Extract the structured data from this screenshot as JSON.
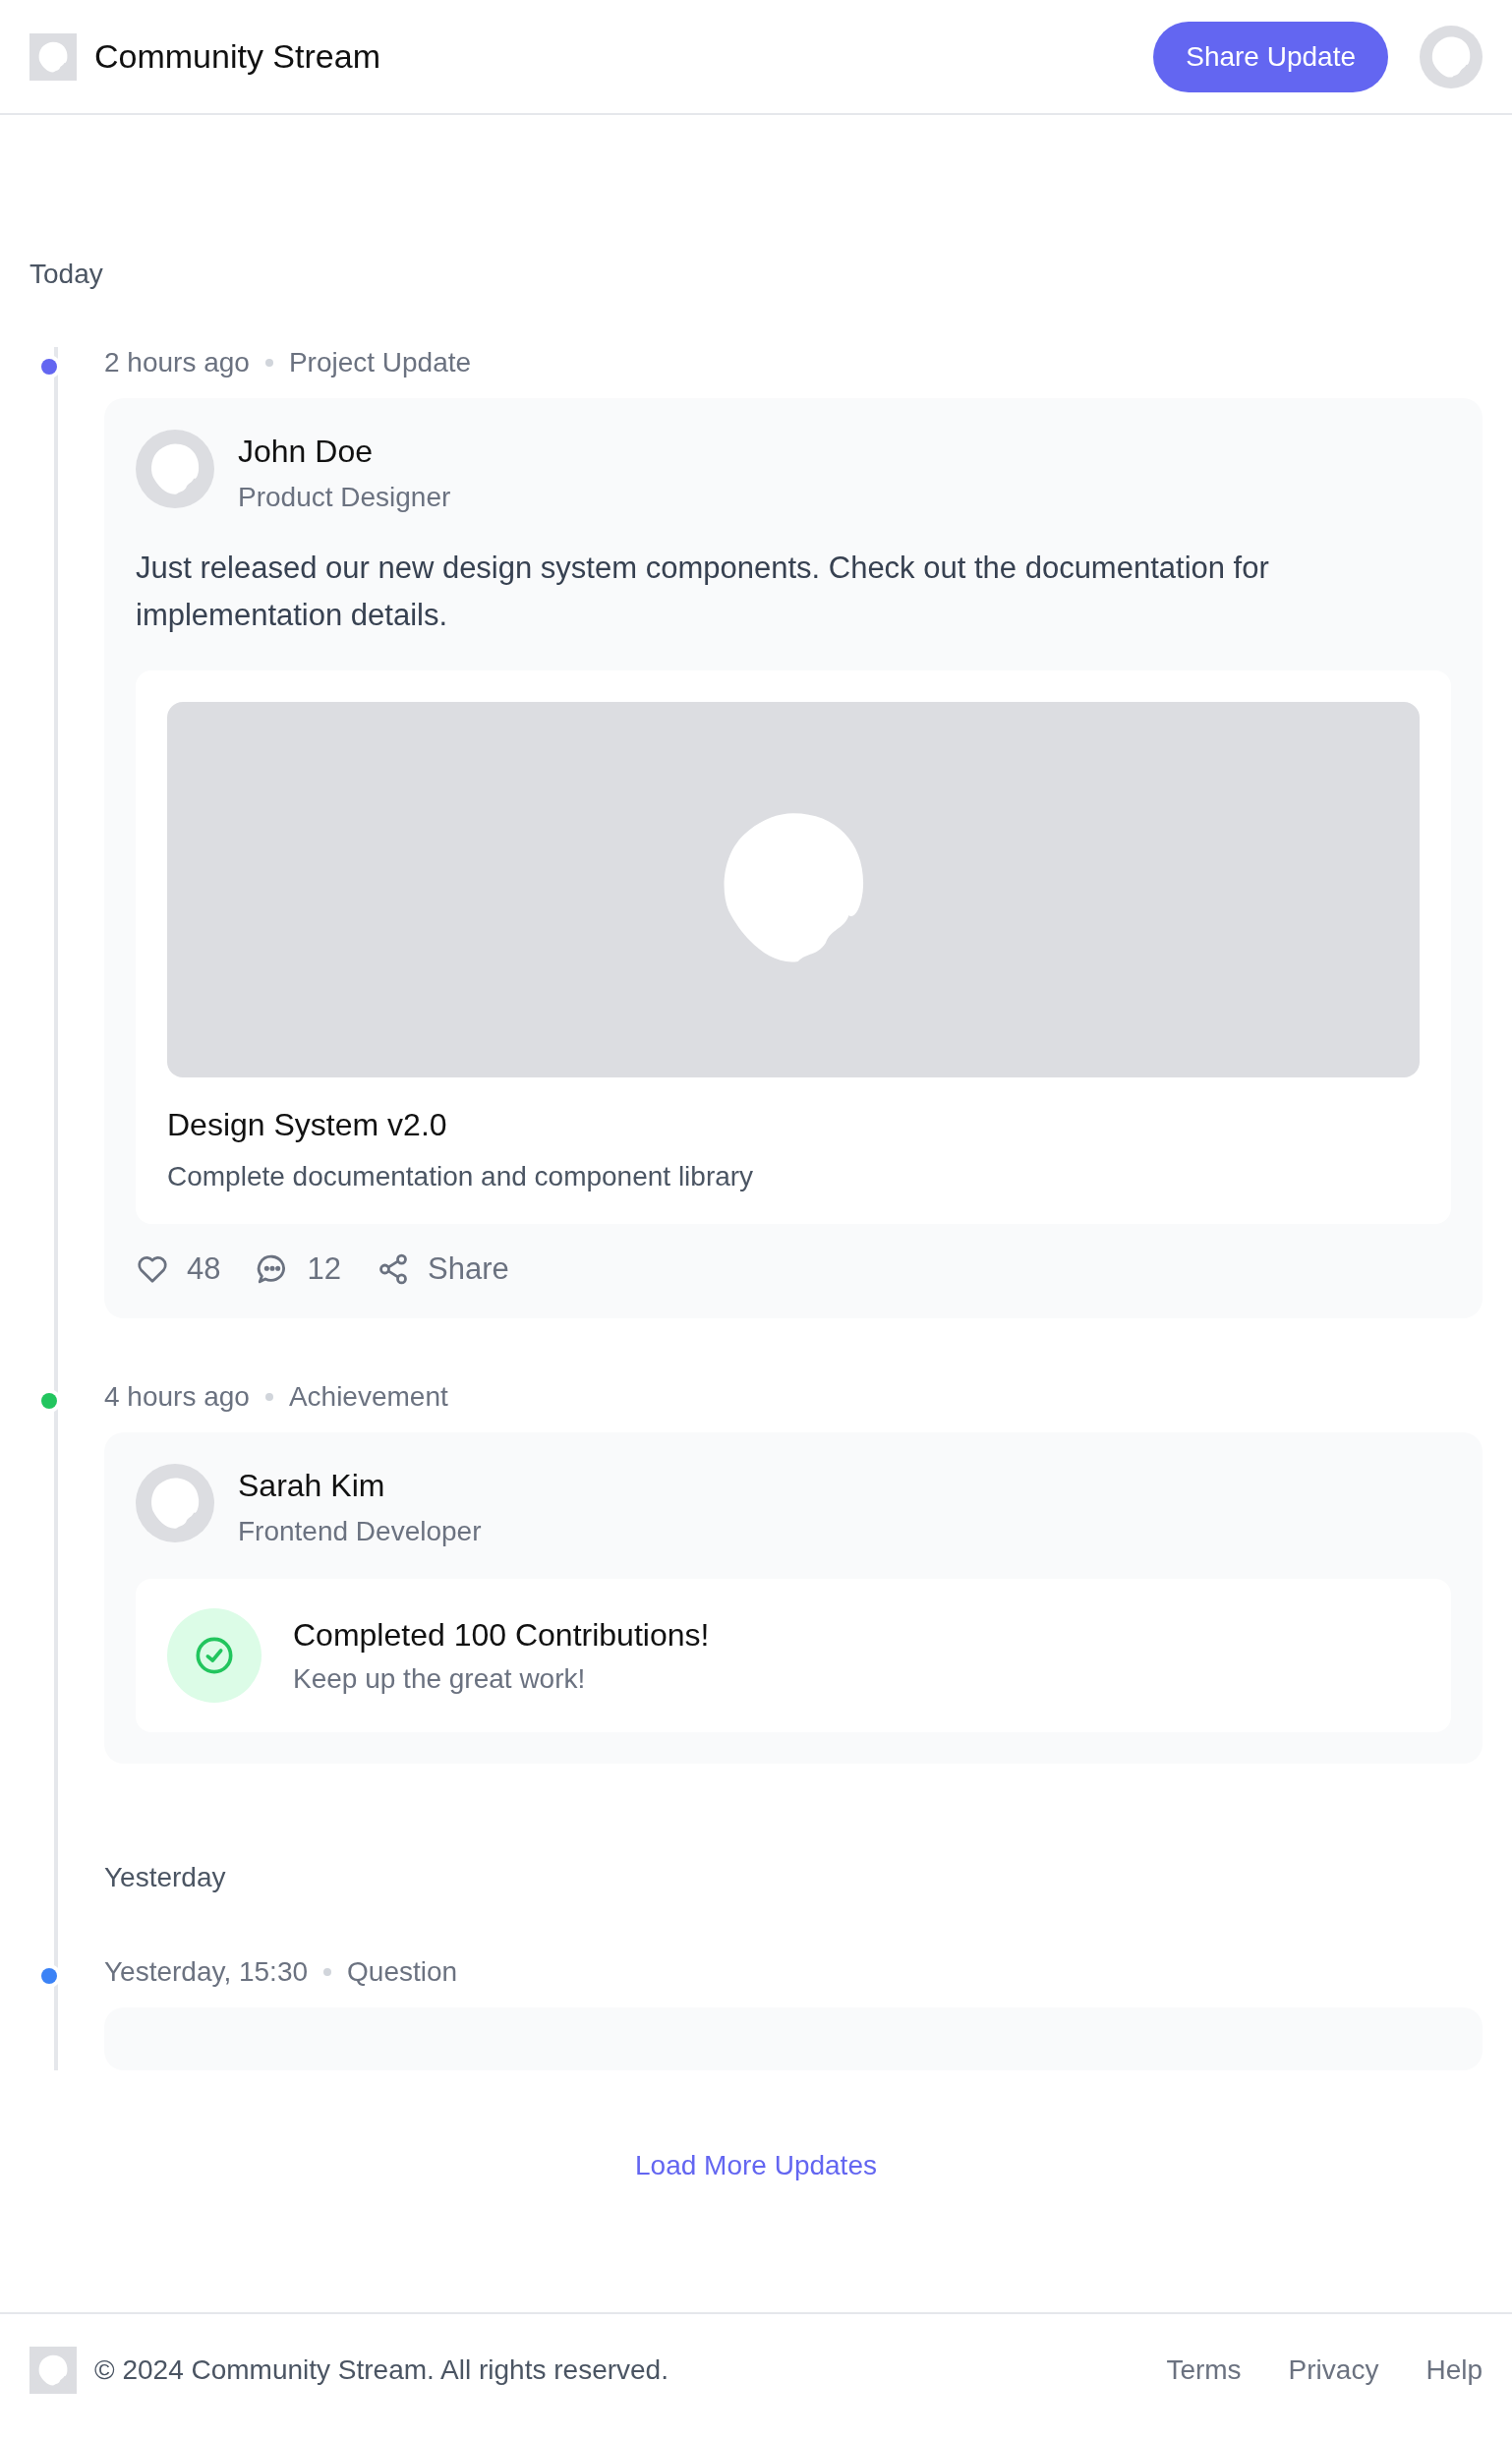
{
  "header": {
    "title": "Community Stream",
    "button": "Share Update"
  },
  "section_label": "Today",
  "timeline": [
    {
      "kind": "post",
      "time": "2 hours ago",
      "category": "Project Update",
      "color": "#6366f1",
      "author": {
        "name": "John Doe",
        "role": "Product Designer"
      },
      "text": "Just released our new design system components. Check out the documentation for implementation details.",
      "attachment": {
        "title": "Design System v2.0",
        "description": "Complete documentation and component library"
      },
      "actions": {
        "likes": "48",
        "comments": "12",
        "share": "Share"
      }
    },
    {
      "kind": "achievement",
      "time": "4 hours ago",
      "category": "Achievement",
      "color": "#22c55e",
      "author": {
        "name": "Sarah Kim",
        "role": "Frontend Developer"
      },
      "achievement": {
        "title": "Completed 100 Contributions!",
        "subtitle": "Keep up the great work!"
      }
    },
    {
      "kind": "day",
      "label": "Yesterday"
    },
    {
      "kind": "question",
      "time": "Yesterday, 15:30",
      "category": "Question",
      "color": "#3b82f6"
    }
  ],
  "load_more": "Load More Updates",
  "footer": {
    "copyright": "© 2024 Community Stream. All rights reserved.",
    "links": [
      "Terms",
      "Privacy",
      "Help"
    ]
  }
}
